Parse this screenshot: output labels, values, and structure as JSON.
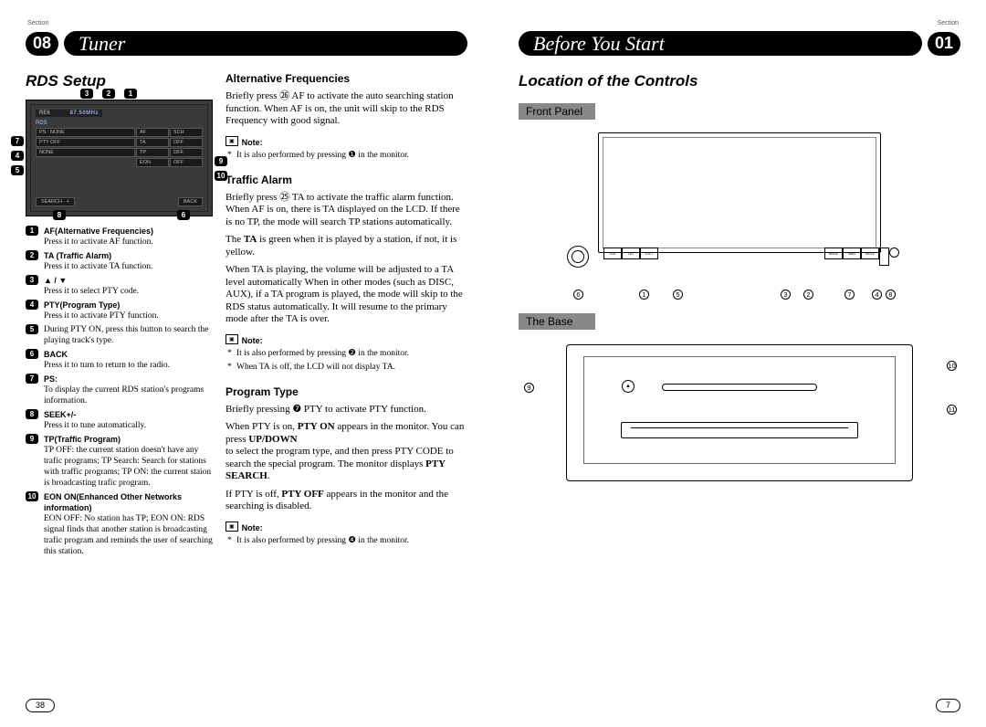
{
  "left": {
    "section_label": "Section",
    "section_num": "08",
    "header": "Tuner",
    "h2": "RDS Setup",
    "screen": {
      "preset": "RE6",
      "freq": "87.50MHz",
      "mode": "RDS",
      "row1_a": "PS : NONE",
      "row1_b": "AF",
      "row1_c": "SCH",
      "row2_a": "PTY OFF",
      "row2_b": "TA",
      "row2_c": "OFF",
      "row3_a": "NONE",
      "row3_b": "TP",
      "row3_c": "OFF",
      "row4_b": "EON",
      "row4_c": "OFF",
      "search": "SEARCH - +",
      "back": "BACK"
    },
    "callouts_top": [
      "3",
      "2",
      "1"
    ],
    "callouts_left": [
      "7",
      "4",
      "5"
    ],
    "callouts_right": [
      "9",
      "10"
    ],
    "callouts_bot": [
      "8",
      "6"
    ],
    "legend": [
      {
        "n": "1",
        "b": "AF(Alternative Frequencies)",
        "d": "Press it to activate AF function."
      },
      {
        "n": "2",
        "b": "TA (Traffic Alarm)",
        "d": "Press it to activate TA function."
      },
      {
        "n": "3",
        "b": "▲ / ▼",
        "d": "Press it to select PTY code."
      },
      {
        "n": "4",
        "b": "PTY(Program Type)",
        "d": "Press it to activate PTY function."
      },
      {
        "n": "5",
        "b": "",
        "d": "During PTY ON, press this button to search the playing track's type."
      },
      {
        "n": "6",
        "b": "BACK",
        "d": "Press it to turn to return to the radio."
      },
      {
        "n": "7",
        "b": "PS:",
        "d": "To display the current RDS station's programs information."
      },
      {
        "n": "8",
        "b": "SEEK+/-",
        "d": "Press it to tune automatically."
      },
      {
        "n": "9",
        "b": "TP(Traffic Program)",
        "d": "TP OFF: the current station doesn't have any trafic programs;\nTP Search: Search for stations with traffic programs;\nTP ON: the current staion is broadcasting trafic program."
      },
      {
        "n": "10",
        "b": "EON ON(Enhanced Other Networks information)",
        "d": "EON OFF: No station has TP;\nEON ON: RDS signal finds that another station is broadcasting trafic program and reminds the user of searching this station."
      }
    ],
    "sections": {
      "af": {
        "h": "Alternative Frequencies",
        "p": "Briefly press ㉖ AF to activate the auto searching station function. When AF is on, the unit will skip to the RDS Frequency with good signal.",
        "note_btn": "▣",
        "note_label": "Note:",
        "notes": [
          "It is also performed by pressing ❶ in the monitor."
        ]
      },
      "ta": {
        "h": "Traffic Alarm",
        "p1": "Briefly press ㉕ TA to activate the traffic alarm function. When AF is on, there is TA displayed on the LCD. If there is no TP, the mode will search TP stations automatically.",
        "p2": "The TA is green when it is played by a station, if not, it is yellow.",
        "p3": "When TA is playing, the volume will be adjusted to a TA level automatically When in other modes (such as DISC, AUX), if a TA program is played, the mode will skip to the RDS status automatically. It will resume to the primary mode after the TA is over.",
        "notes": [
          "It is also performed by pressing ❷ in the monitor.",
          "When TA is off, the LCD will not display TA."
        ]
      },
      "pty": {
        "h": "Program Type",
        "p1": "Briefly pressing ❼ PTY to activate PTY function.",
        "p2": "When PTY is on, PTY ON appears in the monitor. You can press UP/DOWN to select the program type, and then press PTY CODE to search the special program. The monitor displays PTY SEARCH.",
        "p3": "If PTY is off, PTY OFF appears in the monitor and the searching is disabled.",
        "notes": [
          "It is also performed by pressing ❹ in the monitor."
        ]
      }
    },
    "page": "38"
  },
  "right": {
    "section_label": "Section",
    "section_num": "01",
    "header": "Before You Start",
    "h2": "Location of the Controls",
    "fp_label": "Front Panel",
    "base_label": "The Base",
    "fp_btns": [
      "VOL",
      "TILT",
      "EJCT",
      "",
      "MODE",
      "NAVI",
      "MUTE"
    ],
    "fp_callouts": [
      "6",
      "1",
      "5",
      "3",
      "2",
      "7",
      "4",
      "8"
    ],
    "base_callouts": [
      "9",
      "10",
      "11"
    ],
    "eject": "▲",
    "page": "7"
  }
}
